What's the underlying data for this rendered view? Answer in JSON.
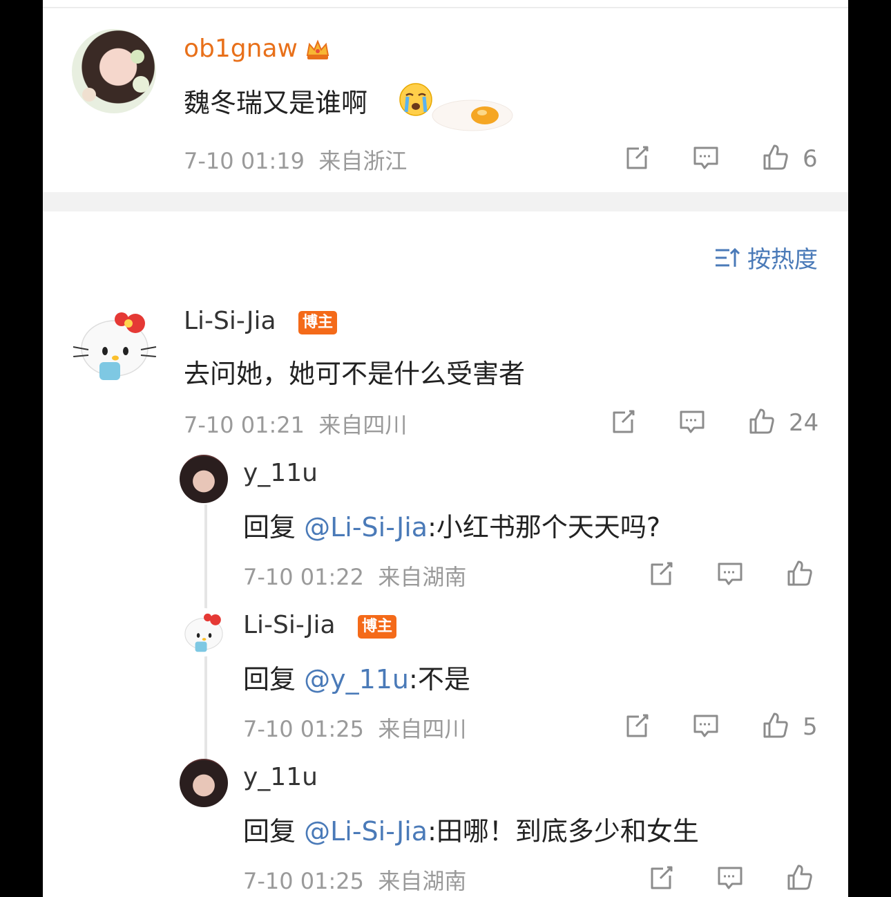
{
  "comments": [
    {
      "username": "ob1gnaw",
      "text": "魏冬瑞又是谁啊",
      "time": "7-10 01:19",
      "location": "来自浙江",
      "likes": "6"
    },
    {
      "username": "Li-Si-Jia",
      "badge": "博主",
      "text": "去问她，她可不是什么受害者",
      "time": "7-10 01:21",
      "location": "来自四川",
      "likes": "24"
    }
  ],
  "sort_label": "按热度",
  "replies": [
    {
      "username": "y_11u",
      "prefix": "回复 ",
      "mention": "@Li-Si-Jia",
      "text": ":小红书那个天天吗?",
      "time": "7-10 01:22",
      "location": "来自湖南",
      "likes": ""
    },
    {
      "username": "Li-Si-Jia",
      "badge": "博主",
      "prefix": "回复 ",
      "mention": "@y_11u",
      "text": ":不是",
      "time": "7-10 01:25",
      "location": "来自四川",
      "likes": "5"
    },
    {
      "username": "y_11u",
      "prefix": "回复 ",
      "mention": "@Li-Si-Jia",
      "text": ":田哪！到底多少和女生",
      "time": "7-10 01:25",
      "location": "来自湖南",
      "likes": ""
    }
  ],
  "colors": {
    "accent": "#4a7ab8",
    "vip_name": "#e8701a",
    "badge": "#f46a19",
    "meta": "#9a9a9a"
  },
  "icons": [
    "crown-icon",
    "crying-emoji-icon",
    "egg-icon",
    "share-icon",
    "comment-icon",
    "like-icon",
    "sort-icon"
  ]
}
